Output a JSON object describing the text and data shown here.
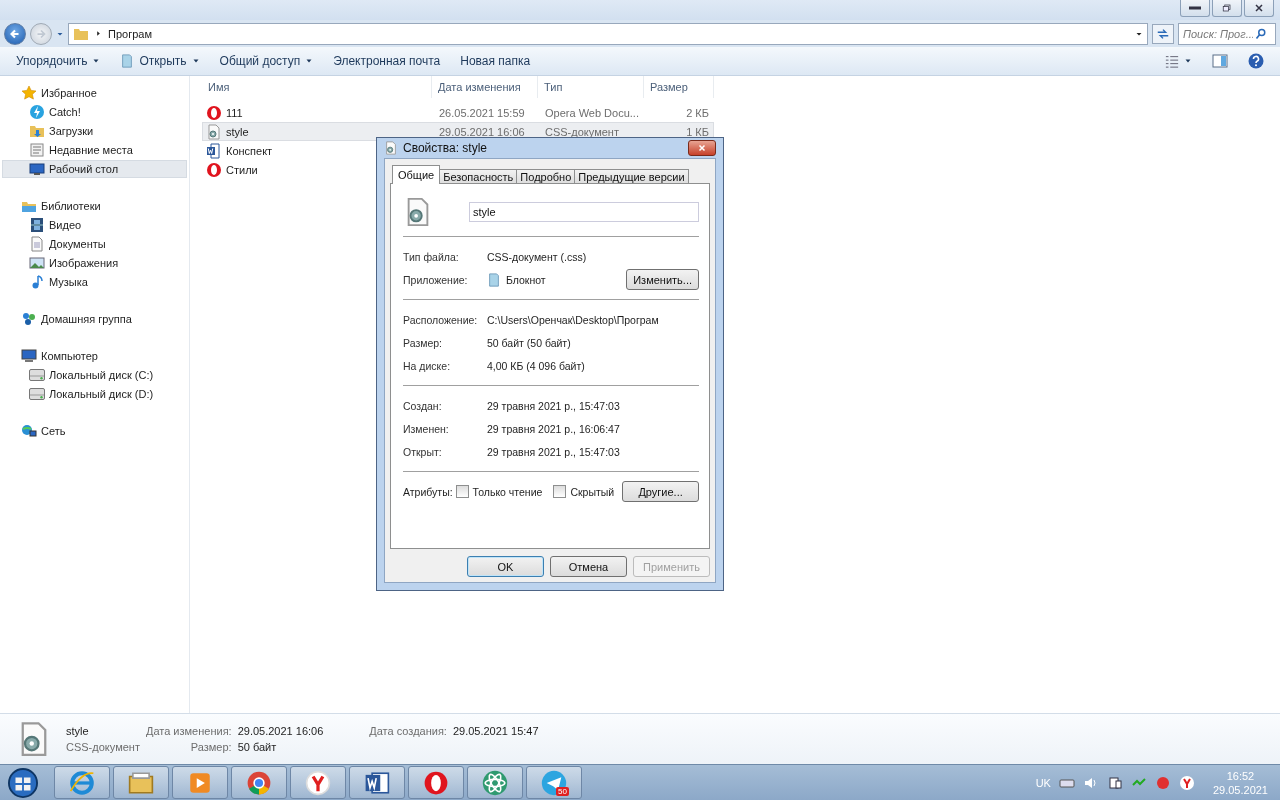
{
  "window": {
    "address": "Програм",
    "search": {
      "placeholder": "Поиск: Прог..."
    }
  },
  "toolbar": [
    {
      "label": "Упорядочить",
      "dropdown": true,
      "kind": "plain"
    },
    {
      "label": "Открыть",
      "dropdown": true,
      "kind": "open"
    },
    {
      "label": "Общий доступ",
      "dropdown": true,
      "kind": "plain"
    },
    {
      "label": "Электронная почта",
      "dropdown": false,
      "kind": "plain"
    },
    {
      "label": "Новая папка",
      "dropdown": false,
      "kind": "plain"
    }
  ],
  "sidebar": [
    {
      "label": "Избранное",
      "kind": "star",
      "selected": false,
      "children": [
        {
          "label": "Catch!",
          "kind": "bolt",
          "selected": false
        },
        {
          "label": "Загрузки",
          "kind": "folder",
          "selected": false
        },
        {
          "label": "Недавние места",
          "kind": "recent",
          "selected": false
        },
        {
          "label": "Рабочий стол",
          "kind": "desktop",
          "selected": true
        }
      ]
    },
    {
      "label": "Библиотеки",
      "kind": "library",
      "selected": false,
      "children": [
        {
          "label": "Видео",
          "kind": "video",
          "selected": false
        },
        {
          "label": "Документы",
          "kind": "doc",
          "selected": false
        },
        {
          "label": "Изображения",
          "kind": "image",
          "selected": false
        },
        {
          "label": "Музыка",
          "kind": "music",
          "selected": false
        }
      ]
    },
    {
      "label": "Домашняя группа",
      "kind": "homegroup",
      "selected": false
    },
    {
      "label": "Компьютер",
      "kind": "computer",
      "selected": false,
      "children": [
        {
          "label": "Локальный диск (C:)",
          "kind": "drive",
          "selected": false
        },
        {
          "label": "Локальный диск (D:)",
          "kind": "drive",
          "selected": false
        }
      ]
    },
    {
      "label": "Сеть",
      "kind": "network",
      "selected": false
    }
  ],
  "table": {
    "columns": [
      "Имя",
      "Дата изменения",
      "Тип",
      "Размер"
    ],
    "rows": [
      {
        "kind": "opera",
        "name": "111",
        "date": "26.05.2021 15:59",
        "type": "Opera Web Docu...",
        "size": "2 КБ",
        "selected": false
      },
      {
        "kind": "css",
        "name": "style",
        "date": "29.05.2021 16:06",
        "type": "CSS-документ",
        "size": "1 КБ",
        "selected": true
      },
      {
        "kind": "word",
        "name": "Конспект",
        "selected": false
      },
      {
        "kind": "opera",
        "name": "Стили",
        "selected": false
      }
    ]
  },
  "dialog": {
    "title": "Свойства: style",
    "tabs": [
      {
        "label": "Общие",
        "selected": true
      },
      {
        "label": "Безопасность",
        "selected": false
      },
      {
        "label": "Подробно",
        "selected": false
      },
      {
        "label": "Предыдущие версии",
        "selected": false
      }
    ],
    "name": "style",
    "sections": [
      [
        {
          "label": "Тип файла:",
          "value": "CSS-документ (.css)",
          "kind": "text"
        },
        {
          "label": "Приложение:",
          "value": "Блокнот",
          "kind": "app",
          "button": "Изменить..."
        }
      ],
      [
        {
          "label": "Расположение:",
          "value": "C:\\Users\\Оренчак\\Desktop\\Програм",
          "kind": "text"
        },
        {
          "label": "Размер:",
          "value": "50 байт (50 байт)",
          "kind": "text"
        },
        {
          "label": "На диске:",
          "value": "4,00 КБ (4 096 байт)",
          "kind": "text"
        }
      ],
      [
        {
          "label": "Создан:",
          "value": "29 травня 2021 р., 15:47:03",
          "kind": "text"
        },
        {
          "label": "Изменен:",
          "value": "29 травня 2021 р., 16:06:47",
          "kind": "text"
        },
        {
          "label": "Открыт:",
          "value": "29 травня 2021 р., 15:47:03",
          "kind": "text"
        }
      ]
    ],
    "attributes": {
      "label": "Атрибуты:",
      "options": [
        {
          "label": "Только чтение",
          "checked": false
        },
        {
          "label": "Скрытый",
          "checked": false
        }
      ],
      "button": "Другие..."
    },
    "buttons": [
      {
        "label": "OK",
        "default": true,
        "disabled": false
      },
      {
        "label": "Отмена",
        "default": false,
        "disabled": false
      },
      {
        "label": "Применить",
        "default": false,
        "disabled": true
      }
    ]
  },
  "details": {
    "name": "style",
    "type": "CSS-документ",
    "fields": [
      {
        "label": "Дата изменения:",
        "value": "29.05.2021 16:06"
      },
      {
        "label": "Размер:",
        "value": "50 байт"
      },
      {
        "label": "Дата создания:",
        "value": "29.05.2021 15:47"
      }
    ]
  },
  "taskbar": {
    "apps": [
      {
        "kind": "ie"
      },
      {
        "kind": "explorer"
      },
      {
        "kind": "media"
      },
      {
        "kind": "chrome"
      },
      {
        "kind": "yandex"
      },
      {
        "kind": "word"
      },
      {
        "kind": "opera"
      },
      {
        "kind": "atom"
      },
      {
        "kind": "telegram",
        "badge": "50"
      }
    ],
    "language": "UK",
    "time": "16:52",
    "date": "29.05.2021"
  }
}
